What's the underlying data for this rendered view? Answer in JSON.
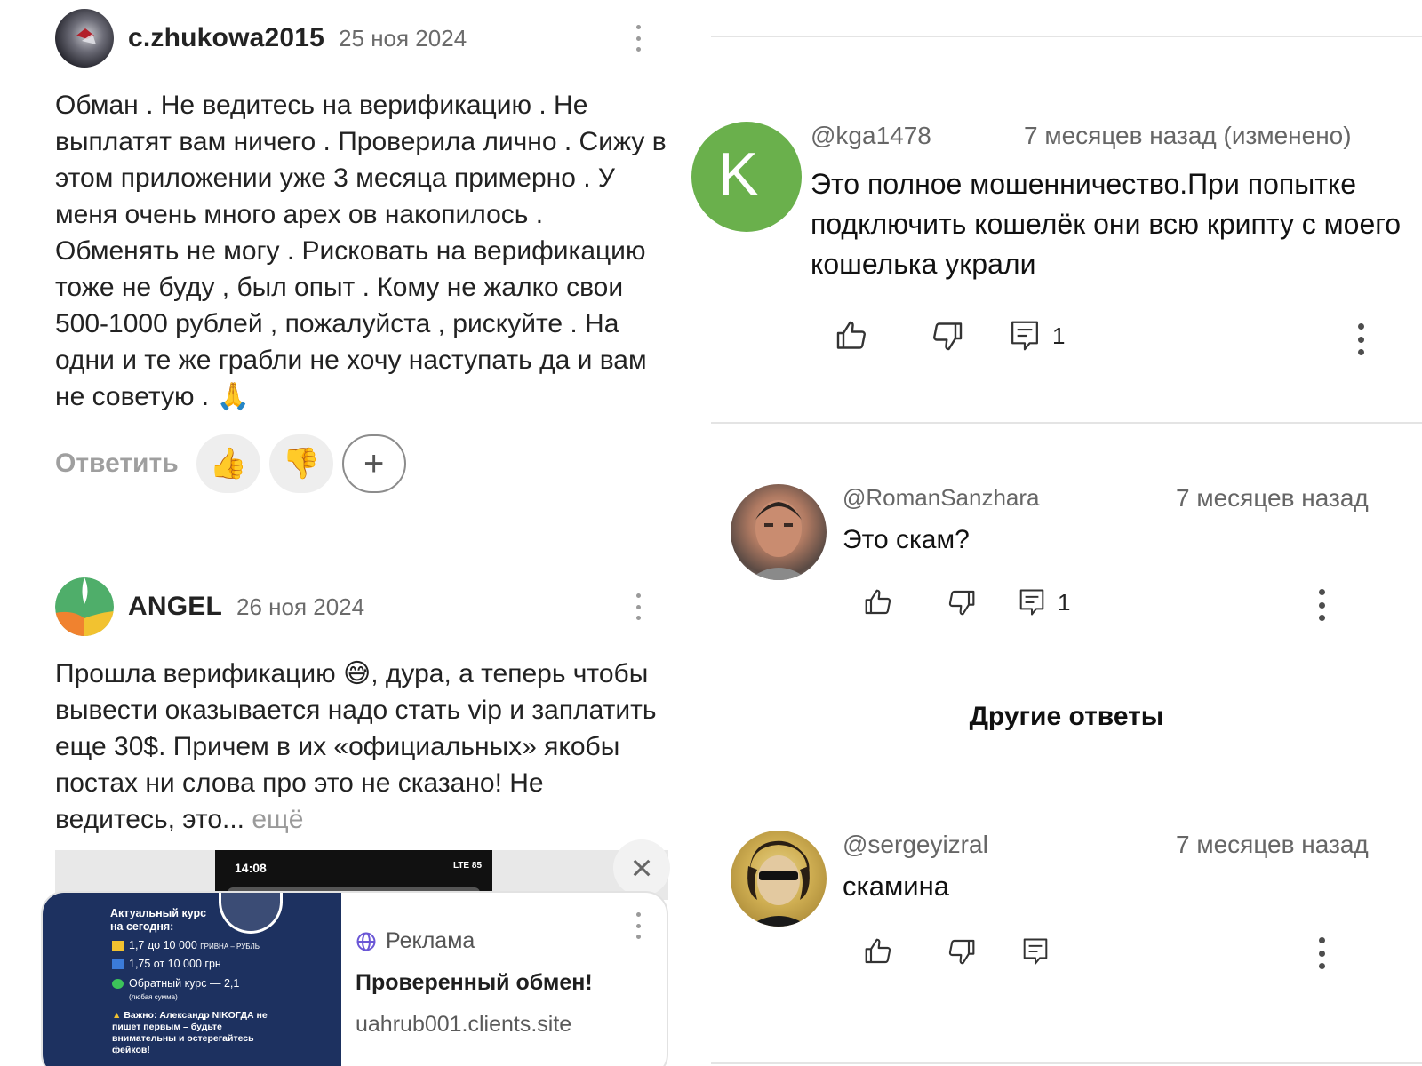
{
  "left": {
    "reviews": [
      {
        "username": "c.zhukowa2015",
        "date": "25 ноя 2024",
        "text": "Обман . Не ведитесь на верификацию . Не выплатят вам ничего . Проверила лично . Сижу в этом приложении уже 3 месяца примерно . У меня очень много apex ов накопилось . Обменять не могу . Рисковать на верификацию тоже не буду , был опыт . Кому не жалко свои 500-1000 рублей , пожалуйста , рискуйте . На одни и те же грабли не хочу наступать да и вам не советую .",
        "emoji": "🙏",
        "reply_label": "Ответить",
        "reactions": [
          "👍",
          "👎"
        ],
        "add_reaction": "+"
      },
      {
        "username": "ANGEL",
        "date": "26 ноя 2024",
        "text_line_1": "Прошла верификацию",
        "emoji": "😅",
        "text_rest": ", дура, а теперь чтобы вывести оказывается надо стать vip и заплатить еще 30$. Причем в их «официальных» якобы постах ни слова про это не сказано! Не ведитесь, это...",
        "more_label": "ещё"
      }
    ],
    "ad": {
      "close_icon": "×",
      "tag": "Реклама",
      "title": "Проверенный обмен!",
      "url": "uahrub001.clients.site",
      "phone_time": "14:08",
      "phone_status": "LTE 85",
      "image": {
        "heading": "Актуальный курс на сегодня:",
        "pair": "ГРИВНА – РУБЛЬ",
        "rate_1": "1,7 до 10 000",
        "rate_2": "1,75 от 10 000 грн",
        "reverse": "Обратный курс — 2,1",
        "reverse_note": "(любая сумма)",
        "warning": "Важно: Александр NIKОГДА не пишет первым – будьте внимательны и остерегайтесь фейков!"
      }
    }
  },
  "right": {
    "comments": [
      {
        "handle": "@kga1478",
        "time": "7 месяцев назад (изменено)",
        "text": "Это полное мошенничество.При попытке подключить кошелёк они всю крипту с моего кошелька украли",
        "avatar_letter": "K",
        "avatar_color": "#6ab04c",
        "reply_count": "1"
      },
      {
        "handle": "@RomanSanzhara",
        "time": "7 месяцев назад",
        "text": "Это скам?",
        "reply_count": "1"
      },
      {
        "handle": "@sergeyizral",
        "time": "7 месяцев назад",
        "text": "скамина"
      }
    ],
    "other_replies": "Другие ответы"
  }
}
